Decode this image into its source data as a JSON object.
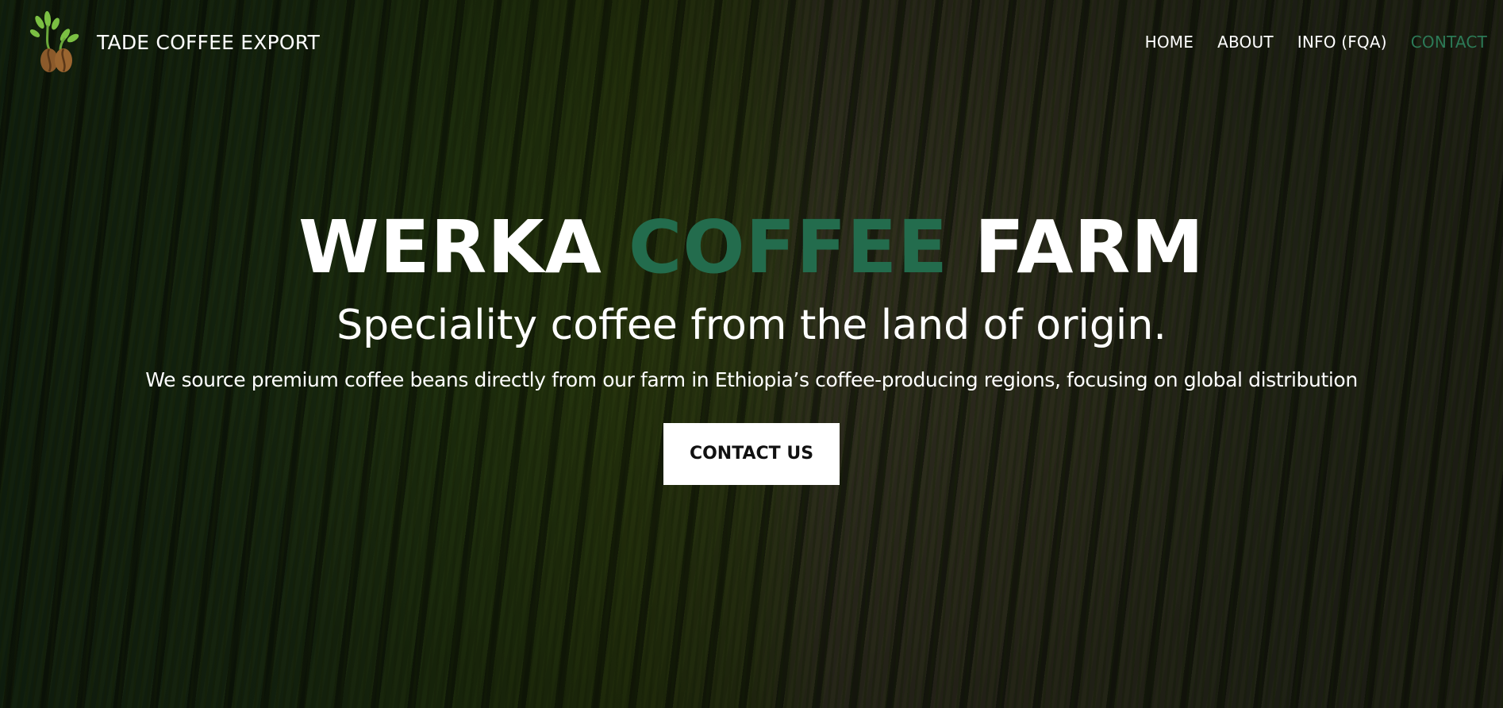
{
  "header": {
    "brand_name": "TADE COFFEE EXPORT",
    "logo_icon": "coffee-bean-sprout-icon",
    "nav": [
      {
        "label": "HOME",
        "active": false
      },
      {
        "label": "ABOUT",
        "active": false
      },
      {
        "label": "INFO (FQA)",
        "active": false
      },
      {
        "label": "CONTACT",
        "active": true
      }
    ]
  },
  "hero": {
    "headline_part1": "WERKA",
    "headline_accent": "COFFEE",
    "headline_part2": "FARM",
    "tagline": "Speciality coffee from the land of origin.",
    "description": "We source premium coffee beans directly from our farm in Ethiopia’s coffee-producing regions, focusing on global distribution",
    "cta_label": "CONTACT US"
  },
  "colors": {
    "accent_green": "#236c4d",
    "nav_active": "#2c7a57",
    "cta_background": "#ffffff",
    "text": "#ffffff"
  }
}
